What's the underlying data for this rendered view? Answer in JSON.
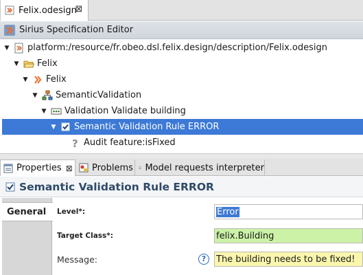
{
  "editor": {
    "tab_label": "Felix.odesign",
    "close_glyph": "⊠",
    "header_title": "Sirius Specification Editor"
  },
  "tree": {
    "rows": [
      {
        "label": "platform:/resource/fr.obeo.dsl.felix.design/description/Felix.odesign",
        "icon": "resource-file-icon"
      },
      {
        "label": "Felix",
        "icon": "folder-open-icon"
      },
      {
        "label": "Felix",
        "icon": "sirius-viewpoint-icon"
      },
      {
        "label": "SemanticValidation",
        "icon": "validation-set-icon"
      },
      {
        "label": "Validation Validate building",
        "icon": "validation-rule-icon"
      },
      {
        "label": "Semantic Validation Rule ERROR",
        "icon": "checkbox-icon"
      },
      {
        "label": "Audit feature:isFixed",
        "icon": "question-mark-icon"
      }
    ]
  },
  "views": {
    "tabs": [
      {
        "label": "Properties",
        "icon": "properties-icon"
      },
      {
        "label": "Problems",
        "icon": "problems-icon"
      },
      {
        "label": "Model requests interpreter",
        "icon": "interpreter-icon"
      }
    ],
    "close_glyph": "⊠"
  },
  "properties": {
    "title": "Semantic Validation Rule ERROR",
    "category": "General",
    "fields": {
      "level_label": "Level*:",
      "level_value": "Error",
      "target_class_label": "Target Class*:",
      "target_class_value": "felix.Building",
      "message_label": "Message:",
      "message_value": "The building needs to be fixed!",
      "help_glyph": "?"
    }
  },
  "colors": {
    "selection": "#3d79d6",
    "title_text": "#2f4a68",
    "target_class_bg": "#ccf2a7",
    "message_bg": "#fbf6ae"
  }
}
